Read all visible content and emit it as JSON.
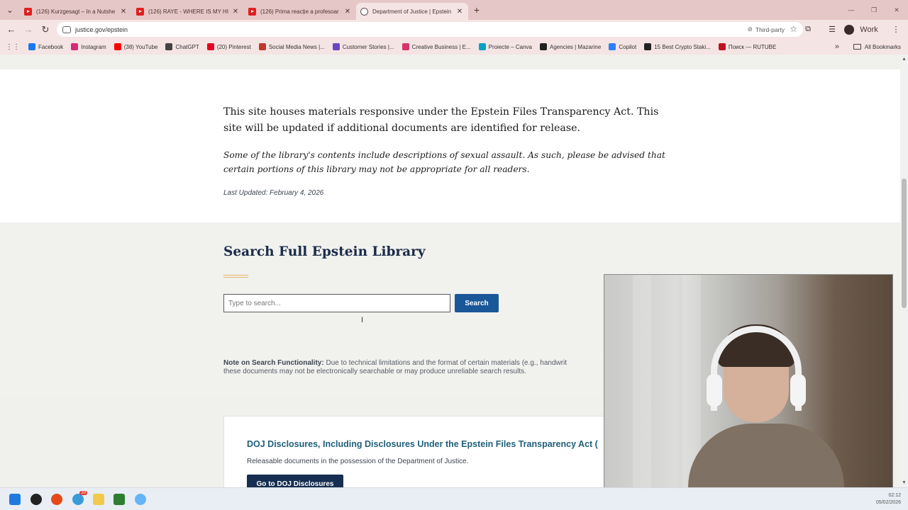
{
  "browser": {
    "tabs": [
      {
        "label": "(126) Kurzgesagt – In a Nutshe",
        "active": false
      },
      {
        "label": "(126) RAYE - WHERE IS MY HUS",
        "active": false
      },
      {
        "label": "(126) Prima reacție a profesoar",
        "active": false
      },
      {
        "label": "Department of Justice | Epstein",
        "active": true
      }
    ],
    "address": "justice.gov/epstein",
    "third_party_label": "Third-party",
    "profile_label": "Work",
    "bookmarks": [
      {
        "label": "Facebook",
        "color": "#1877f2"
      },
      {
        "label": "Instagram",
        "color": "#d62976"
      },
      {
        "label": "(38) YouTube",
        "color": "#ff0000"
      },
      {
        "label": "ChatGPT",
        "color": "#444444"
      },
      {
        "label": "(20) Pinterest",
        "color": "#e60023"
      },
      {
        "label": "Social Media News |...",
        "color": "#c0392b"
      },
      {
        "label": "Customer Stories |...",
        "color": "#6b46c1"
      },
      {
        "label": "Creative Business | E...",
        "color": "#d6336c"
      },
      {
        "label": "Proiecte – Canva",
        "color": "#00a3c4"
      },
      {
        "label": "Agencies | Mazarine",
        "color": "#222222"
      },
      {
        "label": "Copilot",
        "color": "#2d7ff9"
      },
      {
        "label": "15 Best Crypto Staki...",
        "color": "#222222"
      },
      {
        "label": "Поиск — RUTUBE",
        "color": "#c0121f"
      }
    ],
    "all_bookmarks_label": "All Bookmarks"
  },
  "page": {
    "intro": "This site houses materials responsive under the Epstein Files Transparency Act. This site will be updated if additional documents are identified for release.",
    "warning": "Some of the library's contents include descriptions of sexual assault. As such, please be advised that certain portions of this library may not be appropriate for all readers.",
    "last_updated": "Last Updated: February 4, 2026",
    "search": {
      "title": "Search Full Epstein Library",
      "placeholder": "Type to search...",
      "button": "Search",
      "note_label": "Note on Search Functionality:",
      "note_line1": " Due to technical limitations and the format of certain materials (e.g., handwrit",
      "note_line2": "these documents may not be electronically searchable or may produce unreliable search results."
    },
    "disclosures": {
      "title": "DOJ Disclosures, Including Disclosures Under the Epstein Files Transparency Act (",
      "description": "Releasable documents in the possession of the Department of Justice.",
      "button": "Go to DOJ Disclosures"
    }
  },
  "taskbar": {
    "time": "02:12",
    "date": "05/02/2026",
    "badge": "20"
  }
}
